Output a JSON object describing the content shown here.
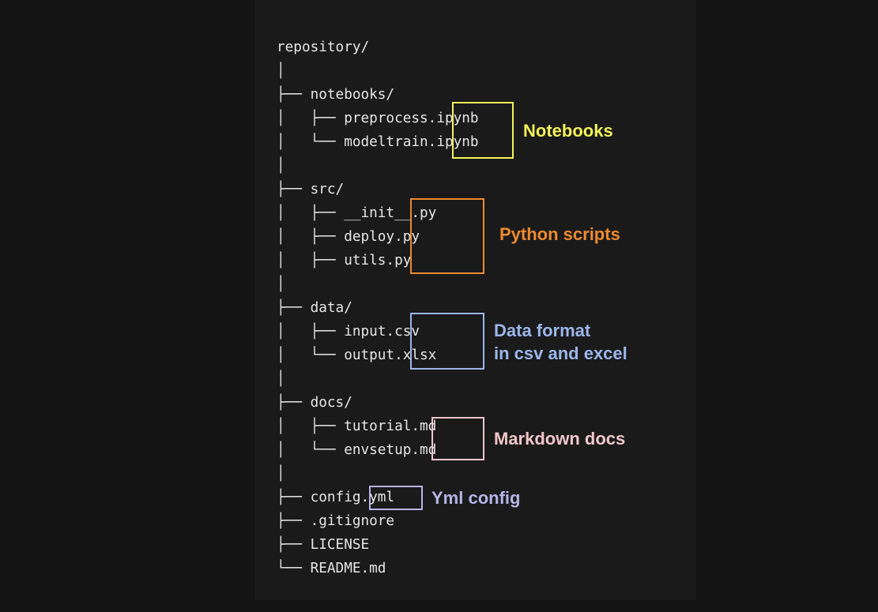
{
  "tree": {
    "lines": [
      "repository/",
      "│",
      "├── notebooks/",
      "│   ├── preprocess.ipynb",
      "│   └── modeltrain.ipynb",
      "│",
      "├── src/",
      "│   ├── __init__.py",
      "│   ├── deploy.py",
      "│   ├── utils.py",
      "│",
      "├── data/",
      "│   ├── input.csv",
      "│   └── output.xlsx",
      "│",
      "├── docs/",
      "│   ├── tutorial.md",
      "│   └── envsetup.md",
      "│",
      "├── config.yml",
      "├── .gitignore",
      "├── LICENSE",
      "└── README.md"
    ]
  },
  "annotations": [
    {
      "label": "Notebooks",
      "color": "#f3f35a"
    },
    {
      "label": "Python scripts",
      "color": "#ee8a2e"
    },
    {
      "label_line1": "Data format",
      "label_line2": "in csv and excel",
      "color": "#9cb6ea"
    },
    {
      "label": "Markdown docs",
      "color": "#f1c6cc"
    },
    {
      "label": "Yml config",
      "color": "#b9b3e9"
    }
  ]
}
